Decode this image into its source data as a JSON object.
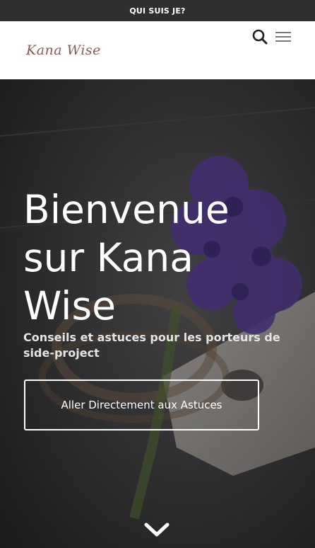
{
  "topbar": {
    "label": "QUI SUIS JE?"
  },
  "header": {
    "logo_text": "Kana Wise",
    "search_icon": "search-icon",
    "menu_icon": "hamburger-menu-icon"
  },
  "hero": {
    "title": "Bienvenue sur Kana Wise",
    "subtitle": "Conseils et astuces pour les porteurs de side-project",
    "cta_label": "Aller Directement aux Astuces",
    "scroll_icon": "chevron-down-icon"
  },
  "colors": {
    "topbar_bg": "#2f2f2f",
    "logo": "#8b5a55",
    "hero_text": "#ffffff",
    "flower": "#5b3f9a"
  }
}
